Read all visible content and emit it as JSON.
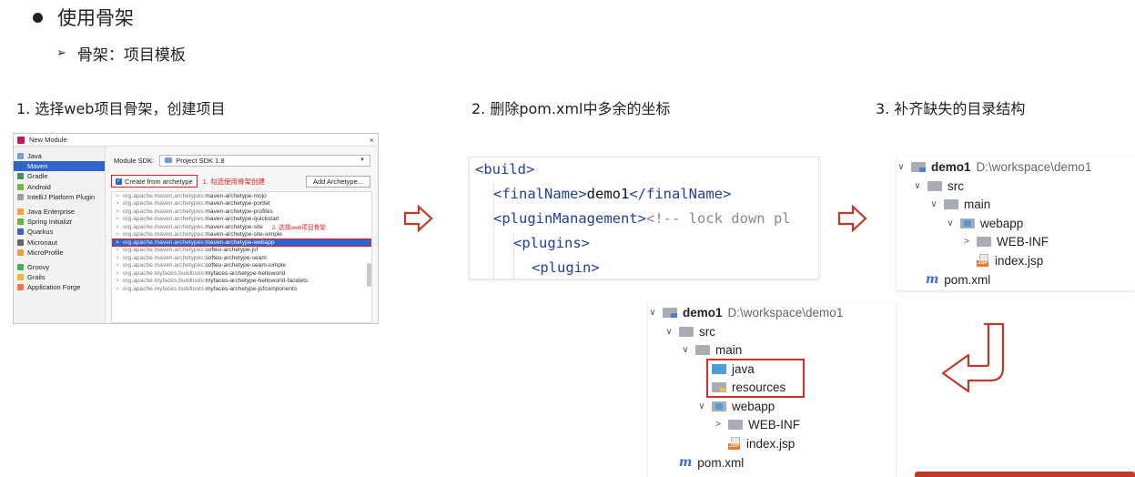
{
  "heading": "使用骨架",
  "subheading": "骨架：项目模板",
  "steps": [
    {
      "title": "1. 选择web项目骨架，创建项目"
    },
    {
      "title": "2. 删除pom.xml中多余的坐标"
    },
    {
      "title": "3. 补齐缺失的目录结构"
    }
  ],
  "dialog": {
    "title": "New Module",
    "close": "×",
    "sidebar": [
      {
        "label": "Java",
        "icon": "java-folder-icon",
        "color": "#7a9fc9"
      },
      {
        "label": "Maven",
        "icon": "maven-icon",
        "color": "#2f65ca",
        "selected": true
      },
      {
        "label": "Gradle",
        "icon": "gradle-icon",
        "color": "#4b8a6b"
      },
      {
        "label": "Android",
        "icon": "android-icon",
        "color": "#7cb342"
      },
      {
        "label": "IntelliJ Platform Plugin",
        "icon": "plugin-icon",
        "color": "#9e9e9e"
      },
      {
        "label": "Java Enterprise",
        "icon": "enterprise-icon",
        "color": "#f2a33a",
        "gap": true
      },
      {
        "label": "Spring Initializr",
        "icon": "spring-icon",
        "color": "#6db33f"
      },
      {
        "label": "Quarkus",
        "icon": "quarkus-icon",
        "color": "#3d66c2"
      },
      {
        "label": "Micronaut",
        "icon": "micronaut-icon",
        "color": "#666666"
      },
      {
        "label": "MicroProfile",
        "icon": "microprofile-icon",
        "color": "#e9a23b"
      },
      {
        "label": "Groovy",
        "icon": "groovy-icon",
        "color": "#4caf50",
        "gap": true
      },
      {
        "label": "Grails",
        "icon": "grails-icon",
        "color": "#f2b63c"
      },
      {
        "label": "Application Forge",
        "icon": "forge-icon",
        "color": "#ff7043"
      }
    ],
    "sdk_label": "Module SDK:",
    "sdk_value": "Project SDK 1.8",
    "create_label": "Create from archetype",
    "note1": "1. 勾选使用骨架创建",
    "add_button": "Add Archetype...",
    "archetypes": [
      {
        "group": "org.apache.maven.archetypes:",
        "name": "maven-archetype-mojo"
      },
      {
        "group": "org.apache.maven.archetypes:",
        "name": "maven-archetype-portlet"
      },
      {
        "group": "org.apache.maven.archetypes:",
        "name": "maven-archetype-profiles"
      },
      {
        "group": "org.apache.maven.archetypes:",
        "name": "maven-archetype-quickstart"
      },
      {
        "group": "org.apache.maven.archetypes:",
        "name": "maven-archetype-site",
        "note": "2. 选择web项目骨架"
      },
      {
        "group": "org.apache.maven.archetypes:",
        "name": "maven-archetype-site-simple"
      },
      {
        "group": "org.apache.maven.archetypes:",
        "name": "maven-archetype-webapp",
        "selected": true
      },
      {
        "group": "org.apache.maven.archetypes:",
        "name": "softeu-archetype-jsf"
      },
      {
        "group": "org.apache.maven.archetypes:",
        "name": "softeu-archetype-seam"
      },
      {
        "group": "org.apache.maven.archetypes:",
        "name": "softeu-archetype-seam-simple"
      },
      {
        "group": "org.apache.myfaces.buildtools:",
        "name": "myfaces-archetype-helloworld"
      },
      {
        "group": "org.apache.myfaces.buildtools:",
        "name": "myfaces-archetype-helloworld-facelets"
      },
      {
        "group": "org.apache.myfaces.buildtools:",
        "name": "myfaces-archetype-jsfcomponents"
      }
    ]
  },
  "code": {
    "lines": [
      {
        "parts": [
          {
            "cls": "tag",
            "t": "<build>"
          }
        ]
      },
      {
        "parts": [
          {
            "cls": "tag",
            "t": "<finalName>"
          },
          {
            "cls": "txt",
            "t": "demo1"
          },
          {
            "cls": "tag",
            "t": "</finalName>"
          }
        ]
      },
      {
        "parts": [
          {
            "cls": "tag",
            "t": "<pluginManagement>"
          },
          {
            "cls": "cmt",
            "t": "<!-- lock down pl"
          }
        ]
      },
      {
        "parts": [
          {
            "cls": "tag",
            "t": "<plugins>"
          }
        ]
      },
      {
        "parts": [
          {
            "cls": "tag",
            "t": "<plugin>"
          }
        ]
      }
    ]
  },
  "tree_top": {
    "rows": [
      {
        "chev": "∨",
        "icon": "module-folder-icon",
        "label": "demo1",
        "path": "D:\\workspace\\demo1",
        "bold": true
      },
      {
        "chev": "∨",
        "icon": "folder-icon",
        "label": "src"
      },
      {
        "chev": "∨",
        "icon": "folder-icon",
        "label": "main"
      },
      {
        "chev": "∨",
        "icon": "webapp-folder-icon",
        "label": "webapp"
      },
      {
        "chev": ">",
        "icon": "folder-icon",
        "label": "WEB-INF"
      },
      {
        "chev": "",
        "icon": "jsp-file-icon",
        "label": "index.jsp"
      },
      {
        "chev": "",
        "icon": "maven-pom-icon",
        "label": "pom.xml"
      }
    ]
  },
  "tree_bottom": {
    "rows": [
      {
        "chev": "∨",
        "icon": "module-folder-icon",
        "label": "demo1",
        "path": "D:\\workspace\\demo1",
        "bold": true
      },
      {
        "chev": "∨",
        "icon": "folder-icon",
        "label": "src"
      },
      {
        "chev": "∨",
        "icon": "folder-icon",
        "label": "main"
      },
      {
        "chev": "",
        "icon": "java-source-folder-icon",
        "label": "java"
      },
      {
        "chev": "",
        "icon": "resources-folder-icon",
        "label": "resources"
      },
      {
        "chev": "∨",
        "icon": "webapp-folder-icon",
        "label": "webapp"
      },
      {
        "chev": ">",
        "icon": "folder-icon",
        "label": "WEB-INF"
      },
      {
        "chev": "",
        "icon": "jsp-file-icon",
        "label": "index.jsp"
      },
      {
        "chev": "",
        "icon": "maven-pom-icon",
        "label": "pom.xml"
      }
    ]
  },
  "colors": {
    "arrow": "#c0392b",
    "highlight": "#d0312d",
    "selection": "#2f65ca"
  }
}
